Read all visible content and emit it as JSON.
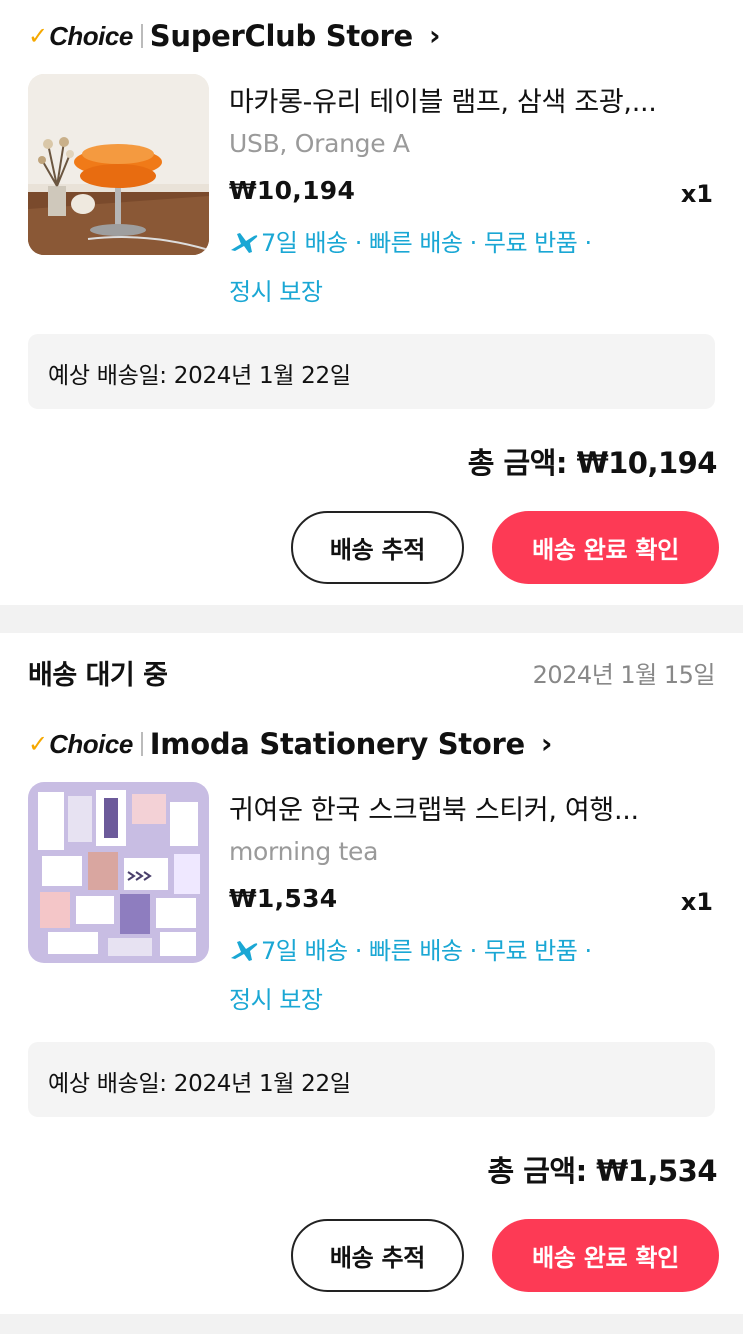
{
  "colors": {
    "accent": "#fd3a55",
    "shipping_blue": "#1aa7d4",
    "choice_check": "#f5a800",
    "muted": "#9a9a9a"
  },
  "orders": [
    {
      "status": "",
      "date": "",
      "store": {
        "brand": "Choice",
        "name": "SuperClub Store"
      },
      "product": {
        "title": "마카롱-유리 테이블 램프, 삼색 조광,...",
        "variant": "USB, Orange A",
        "price": "₩10,194",
        "qty": "x1",
        "shipping": "7일 배송 · 빠른 배송 · 무료 반품 ·",
        "guarantee": "정시 보장",
        "shipping_icon": "airplane-icon"
      },
      "eta": "예상 배송일: 2024년 1월 22일",
      "total_label": "총 금액:",
      "total_value": "₩10,194",
      "track_label": "배송 추적",
      "confirm_label": "배송 완료 확인"
    },
    {
      "status": "배송 대기 중",
      "date": "2024년 1월 15일",
      "store": {
        "brand": "Choice",
        "name": "Imoda Stationery Store"
      },
      "product": {
        "title": "귀여운 한국 스크랩북 스티커, 여행...",
        "variant": "morning tea",
        "price": "₩1,534",
        "qty": "x1",
        "shipping": "7일 배송 · 빠른 배송 · 무료 반품 ·",
        "guarantee": "정시 보장",
        "shipping_icon": "airplane-icon"
      },
      "eta": "예상 배송일: 2024년 1월 22일",
      "total_label": "총 금액:",
      "total_value": "₩1,534",
      "track_label": "배송 추적",
      "confirm_label": "배송 완료 확인"
    }
  ]
}
